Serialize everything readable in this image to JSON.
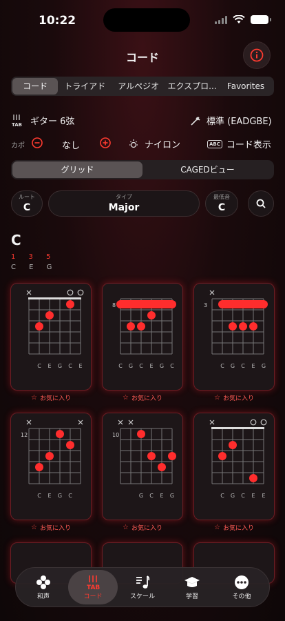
{
  "status": {
    "time": "10:22"
  },
  "header": {
    "title": "コード"
  },
  "tabs": [
    "コード",
    "トライアド",
    "アルペジオ",
    "エクスプロ...",
    "Favorites"
  ],
  "instrument": {
    "name": "ギター 6弦",
    "tuning": "標準 (EADGBE)"
  },
  "capo": {
    "label": "カポ",
    "value": "なし"
  },
  "options": {
    "string_type": "ナイロン",
    "display": "コード表示"
  },
  "view_toggle": [
    "グリッド",
    "CAGEDビュー"
  ],
  "selectors": {
    "root_label": "ルート",
    "root_value": "C",
    "type_label": "タイプ",
    "type_value": "Major",
    "bass_label": "最低音",
    "bass_value": "C"
  },
  "chord": {
    "name": "C",
    "intervals": "1 3 5",
    "notes": "C E G"
  },
  "favorite_label": "お気に入り",
  "voicings": [
    {
      "fret": "",
      "markers": [
        "x",
        "",
        "",
        "",
        "o",
        "o"
      ],
      "barre": null,
      "dots": [
        [
          4,
          1
        ],
        [
          2,
          2
        ],
        [
          1,
          3
        ]
      ],
      "notes": [
        "",
        "C",
        "E",
        "G",
        "C",
        "E"
      ]
    },
    {
      "fret": "8",
      "markers": [
        "",
        "",
        "",
        "",
        "",
        ""
      ],
      "barre": [
        0,
        5,
        1
      ],
      "dots": [
        [
          3,
          2
        ],
        [
          2,
          3
        ],
        [
          1,
          3
        ]
      ],
      "notes": [
        "C",
        "G",
        "C",
        "E",
        "G",
        "C"
      ]
    },
    {
      "fret": "3",
      "markers": [
        "x",
        "",
        "",
        "",
        "",
        ""
      ],
      "barre": [
        1,
        5,
        1
      ],
      "dots": [
        [
          4,
          3
        ],
        [
          3,
          3
        ],
        [
          2,
          3
        ]
      ],
      "notes": [
        "",
        "C",
        "G",
        "C",
        "E",
        "G"
      ]
    },
    {
      "fret": "12",
      "markers": [
        "x",
        "",
        "",
        "",
        "",
        "x"
      ],
      "barre": null,
      "dots": [
        [
          3,
          1
        ],
        [
          4,
          2
        ],
        [
          2,
          3
        ],
        [
          1,
          4
        ]
      ],
      "notes": [
        "",
        "C",
        "E",
        "G",
        "C",
        ""
      ]
    },
    {
      "fret": "10",
      "markers": [
        "x",
        "x",
        "",
        "",
        "",
        ""
      ],
      "barre": null,
      "dots": [
        [
          2,
          1
        ],
        [
          3,
          3
        ],
        [
          5,
          3
        ],
        [
          4,
          4
        ]
      ],
      "notes": [
        "",
        "",
        "G",
        "C",
        "E",
        "G"
      ]
    },
    {
      "fret": "",
      "markers": [
        "x",
        "",
        "",
        "",
        "o",
        "o"
      ],
      "barre": null,
      "dots": [
        [
          2,
          2
        ],
        [
          1,
          3
        ],
        [
          4,
          5
        ]
      ],
      "notes": [
        "",
        "C",
        "G",
        "C",
        "E",
        "E"
      ]
    }
  ],
  "tabbar": [
    {
      "label": "和声",
      "icon": "harmony-icon"
    },
    {
      "label": "コード",
      "icon": "guitar-icon",
      "active": true
    },
    {
      "label": "スケール",
      "icon": "music-note-icon"
    },
    {
      "label": "学習",
      "icon": "graduation-cap-icon"
    },
    {
      "label": "その他",
      "icon": "more-icon"
    }
  ],
  "colors": {
    "accent": "#ff3b30",
    "dot": "#ff2d2d",
    "card_border": "#6b1d24"
  }
}
